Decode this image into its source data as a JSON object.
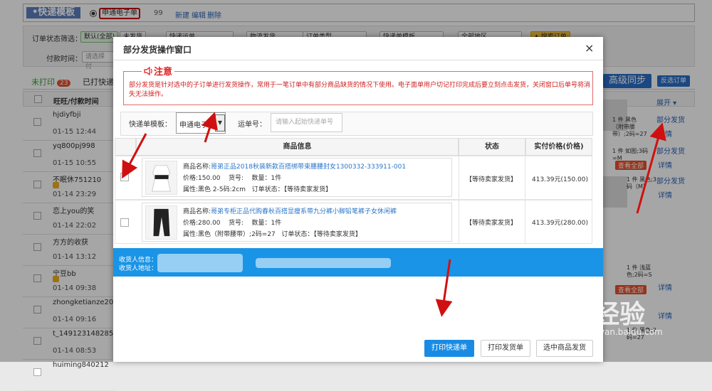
{
  "topbar": {
    "title": "•快递模板",
    "active_template": "申通电子单",
    "count": "99",
    "links": [
      "新建",
      "编辑",
      "删除"
    ]
  },
  "filters": {
    "status_label": "订单状态筛选：",
    "buttons": [
      "默认(全部)",
      "未发货",
      "快递运单",
      "物流发货",
      "订单类型",
      "快递单模板",
      "全部地区"
    ],
    "search_button": "▲ 搜索订单",
    "time_label": "付款时间：",
    "time_placeholder": "请选择付"
  },
  "tabs": {
    "unprinted_label": "未打印",
    "unprinted_count": "23",
    "printed_label": "已打快递"
  },
  "right_buttons": {
    "sync": "高级同步",
    "cancel": "反选订单"
  },
  "grid": {
    "header": "旺旺/付款时间",
    "rows": [
      {
        "name": "hjdiyfbji",
        "date": "01-15 12:44",
        "flag": false
      },
      {
        "name": "yq800pj998",
        "date": "01-15 10:55",
        "flag": false
      },
      {
        "name": "不眠休751210",
        "date": "01-14 23:29",
        "flag": true
      },
      {
        "name": "恋上you的笑",
        "date": "01-14 22:02",
        "flag": false
      },
      {
        "name": "方方的收获",
        "date": "01-14 13:12",
        "flag": false
      },
      {
        "name": "宁豆bb",
        "date": "01-14 09:38",
        "flag": true
      },
      {
        "name": "zhongketianze20",
        "date": "01-14 09:16",
        "flag": false
      },
      {
        "name": "t_149123148285",
        "date": "01-14 08:53",
        "flag": false
      },
      {
        "name": "huiming840212",
        "date": "",
        "flag": false
      }
    ],
    "right_links": {
      "expand": "展开",
      "partial": "部分发货",
      "detail": "详情",
      "view_all": "查看全部"
    },
    "right_texts": [
      "1 件  黑色（附带腰带）;2码=27",
      "1 件  如图;3码=M",
      "1 件  黑色;3码（M）",
      "1 件  浅蓝色;2码=S",
      "1 件  黑色;2码=27"
    ]
  },
  "modal": {
    "title": "部分发货操作窗口",
    "close": "×",
    "notice_title": "注意",
    "notice_text": "部分发货是针对选中的子订单进行发货操作，常用于一笔订单中有部分商品缺货的情况下使用。电子面单用户切记打印完成后要立刻点击发货，关闭窗口后单号将消失无法操作。",
    "template_label": "快递单模板：",
    "template_value": "申通电子单",
    "waybill_label": "运单号：",
    "waybill_placeholder": "请输入起始快递单号",
    "col_product": "商品信息",
    "col_status": "状态",
    "col_price": "实付价格(价格)",
    "products": [
      {
        "name_label": "商品名称:",
        "name": "哥弟正品2018秋装新款百搭绑带束腰腰封女1300332-333911-001",
        "price": "价格:150.00",
        "sku": "货号:",
        "qty": "数量：1件",
        "attr": "属性:黑色 2-5码:2cm",
        "order_status": "订单状态：【等待卖家发货】",
        "status": "【等待卖家发货】",
        "paid": "413.39元(150.00)"
      },
      {
        "name_label": "商品名称:",
        "name": "哥弟专柜正品代购春秋百搭显瘦系带九分裤小脚铅笔裤子女休闲裤",
        "price": "价格:280.00",
        "sku": "货号:",
        "qty": "数量：1件",
        "attr": "属性:黑色（附带腰带）;2码=27",
        "order_status": "订单状态：【等待卖家发货】",
        "status": "【等待卖家发货】",
        "paid": "413.39元(280.00)"
      }
    ],
    "receiver_label": "收货人信息：",
    "address_label": "收货人地址：",
    "buttons": {
      "print_express": "打印快递单",
      "print_invoice": "打印发货单",
      "ship_selected": "选中商品发货"
    }
  },
  "watermark": {
    "brand": "Bai经验",
    "site": "jingyan.baidu.com"
  },
  "colors": {
    "primary": "#1a8be4",
    "notice": "#e02020",
    "arrow": "#d01010"
  }
}
